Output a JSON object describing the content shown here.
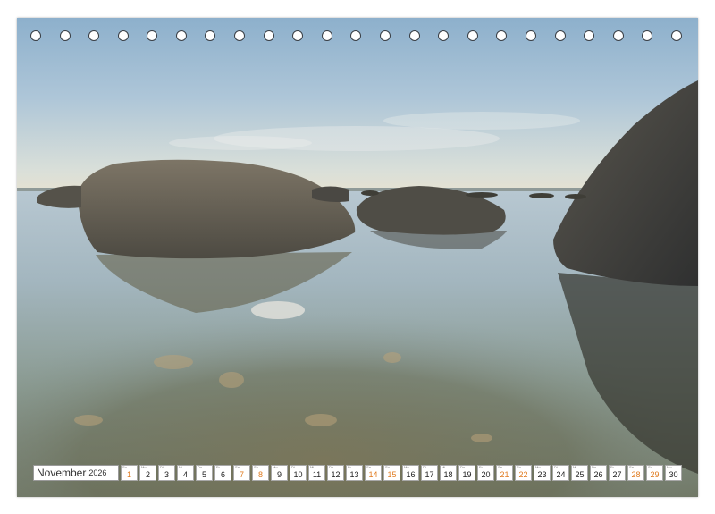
{
  "calendar": {
    "month": "November",
    "year": "2026",
    "days": [
      {
        "wd": "So",
        "d": "1",
        "weekend": true
      },
      {
        "wd": "Mo",
        "d": "2",
        "weekend": false
      },
      {
        "wd": "Di",
        "d": "3",
        "weekend": false
      },
      {
        "wd": "Mi",
        "d": "4",
        "weekend": false
      },
      {
        "wd": "Do",
        "d": "5",
        "weekend": false
      },
      {
        "wd": "Fr",
        "d": "6",
        "weekend": false
      },
      {
        "wd": "Sa",
        "d": "7",
        "weekend": true
      },
      {
        "wd": "So",
        "d": "8",
        "weekend": true
      },
      {
        "wd": "Mo",
        "d": "9",
        "weekend": false
      },
      {
        "wd": "Di",
        "d": "10",
        "weekend": false
      },
      {
        "wd": "Mi",
        "d": "11",
        "weekend": false
      },
      {
        "wd": "Do",
        "d": "12",
        "weekend": false
      },
      {
        "wd": "Fr",
        "d": "13",
        "weekend": false
      },
      {
        "wd": "Sa",
        "d": "14",
        "weekend": true
      },
      {
        "wd": "So",
        "d": "15",
        "weekend": true
      },
      {
        "wd": "Mo",
        "d": "16",
        "weekend": false
      },
      {
        "wd": "Di",
        "d": "17",
        "weekend": false
      },
      {
        "wd": "Mi",
        "d": "18",
        "weekend": false
      },
      {
        "wd": "Do",
        "d": "19",
        "weekend": false
      },
      {
        "wd": "Fr",
        "d": "20",
        "weekend": false
      },
      {
        "wd": "Sa",
        "d": "21",
        "weekend": true
      },
      {
        "wd": "So",
        "d": "22",
        "weekend": true
      },
      {
        "wd": "Mo",
        "d": "23",
        "weekend": false
      },
      {
        "wd": "Di",
        "d": "24",
        "weekend": false
      },
      {
        "wd": "Mi",
        "d": "25",
        "weekend": false
      },
      {
        "wd": "Do",
        "d": "26",
        "weekend": false
      },
      {
        "wd": "Fr",
        "d": "27",
        "weekend": false
      },
      {
        "wd": "Sa",
        "d": "28",
        "weekend": true
      },
      {
        "wd": "So",
        "d": "29",
        "weekend": true
      },
      {
        "wd": "Mo",
        "d": "30",
        "weekend": false
      }
    ]
  },
  "colors": {
    "weekend": "#e07b1f",
    "binding_ring": "#3a3f45"
  }
}
